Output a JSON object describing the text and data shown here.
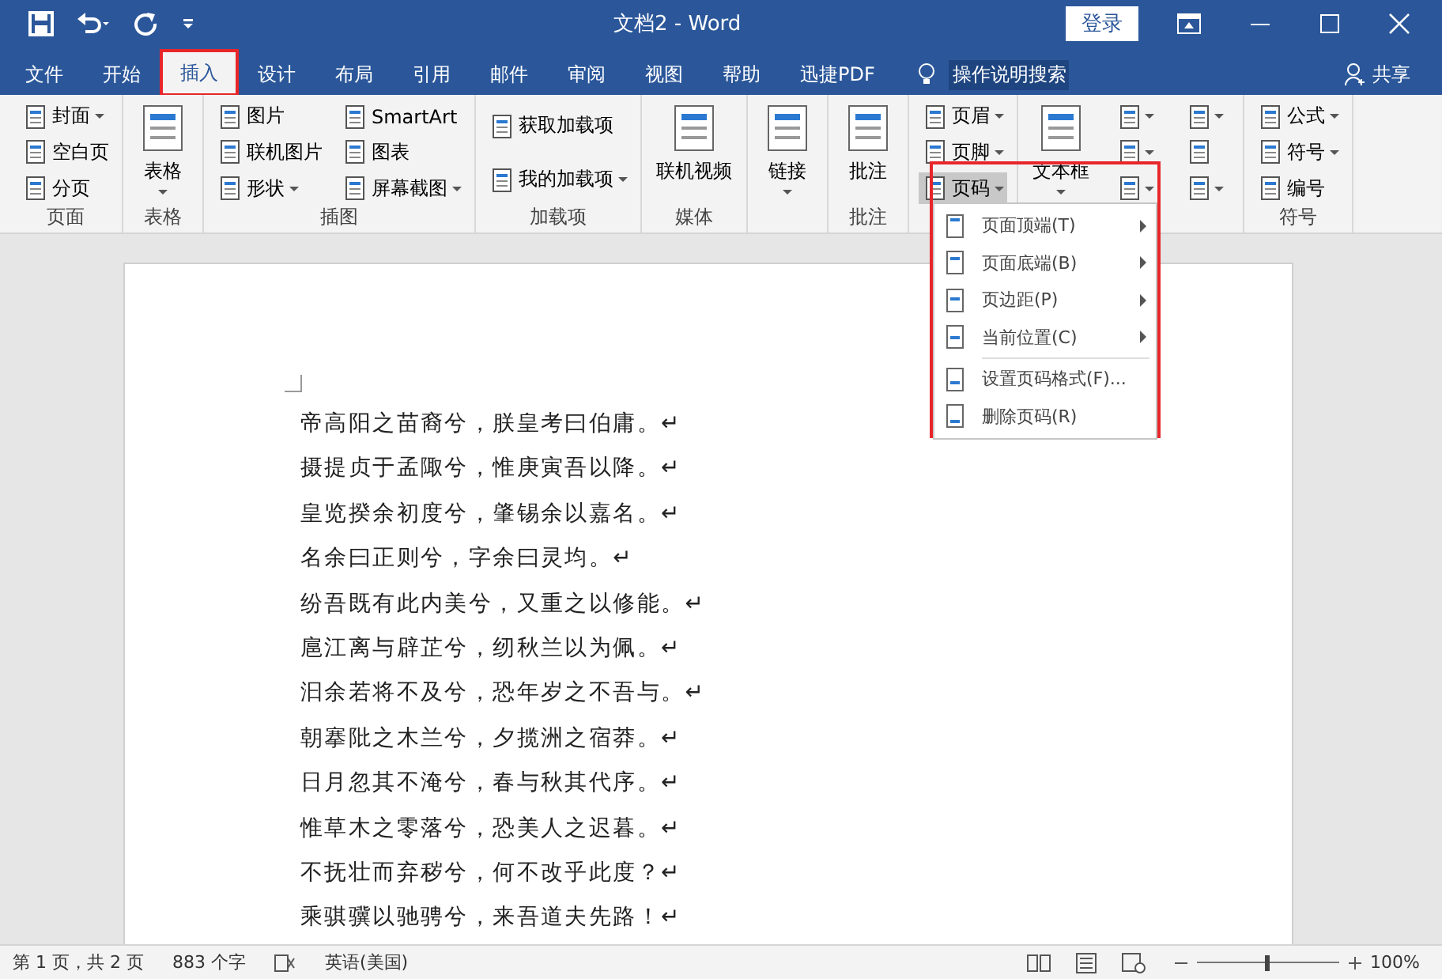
{
  "window": {
    "title": "文档2 - Word",
    "login_button": "登录"
  },
  "tabs": [
    {
      "label": "文件",
      "selected": false
    },
    {
      "label": "开始",
      "selected": false
    },
    {
      "label": "插入",
      "selected": true
    },
    {
      "label": "设计",
      "selected": false
    },
    {
      "label": "布局",
      "selected": false
    },
    {
      "label": "引用",
      "selected": false
    },
    {
      "label": "邮件",
      "selected": false
    },
    {
      "label": "审阅",
      "selected": false
    },
    {
      "label": "视图",
      "selected": false
    },
    {
      "label": "帮助",
      "selected": false
    },
    {
      "label": "迅捷PDF",
      "selected": false
    }
  ],
  "tell_me": "操作说明搜索",
  "share": "共享",
  "ribbon_groups": [
    {
      "label": "页面",
      "items": [
        {
          "kind": "small",
          "label": "封面",
          "dropdown": true
        },
        {
          "kind": "small",
          "label": "空白页",
          "dropdown": false
        },
        {
          "kind": "small",
          "label": "分页",
          "dropdown": false
        }
      ]
    },
    {
      "label": "表格",
      "items": [
        {
          "kind": "large",
          "label": "表格",
          "dropdown": true
        }
      ]
    },
    {
      "label": "插图",
      "items": [
        {
          "kind": "small",
          "label": "图片",
          "dropdown": false
        },
        {
          "kind": "small",
          "label": "联机图片",
          "dropdown": false
        },
        {
          "kind": "small",
          "label": "形状",
          "dropdown": true
        },
        {
          "kind": "small",
          "label": "SmartArt",
          "dropdown": false
        },
        {
          "kind": "small",
          "label": "图表",
          "dropdown": false
        },
        {
          "kind": "small",
          "label": "屏幕截图",
          "dropdown": true
        }
      ]
    },
    {
      "label": "加载项",
      "items": [
        {
          "kind": "small",
          "label": "获取加载项",
          "dropdown": false
        },
        {
          "kind": "small",
          "label": "我的加载项",
          "dropdown": true
        }
      ]
    },
    {
      "label": "媒体",
      "items": [
        {
          "kind": "large",
          "label": "联机视频",
          "dropdown": false
        }
      ]
    },
    {
      "items": [
        {
          "kind": "large",
          "label": "链接",
          "dropdown": true
        }
      ]
    },
    {
      "label": "批注",
      "items": [
        {
          "kind": "large",
          "label": "批注",
          "dropdown": false
        }
      ]
    },
    {
      "items": [
        {
          "kind": "small",
          "label": "页眉",
          "dropdown": true,
          "open": false
        },
        {
          "kind": "small",
          "label": "页脚",
          "dropdown": true,
          "open": false
        },
        {
          "kind": "small",
          "label": "页码",
          "dropdown": true,
          "open": true
        }
      ]
    },
    {
      "items": [
        {
          "kind": "large",
          "label": "文本框",
          "dropdown": true
        },
        {
          "kind": "icon",
          "dropdown": true
        },
        {
          "kind": "icon",
          "dropdown": true
        },
        {
          "kind": "icon",
          "dropdown": true
        },
        {
          "kind": "icon",
          "dropdown": true
        },
        {
          "kind": "icon",
          "dropdown": false
        },
        {
          "kind": "icon",
          "dropdown": true
        }
      ]
    },
    {
      "label": "符号",
      "items": [
        {
          "kind": "small",
          "label": "公式",
          "dropdown": true
        },
        {
          "kind": "small",
          "label": "符号",
          "dropdown": true
        },
        {
          "kind": "small",
          "label": "编号",
          "dropdown": false
        }
      ]
    }
  ],
  "page_number_menu": {
    "items": [
      {
        "label": "页面顶端(T)",
        "submenu": true,
        "separator_before": false
      },
      {
        "label": "页面底端(B)",
        "submenu": true,
        "separator_before": false
      },
      {
        "label": "页边距(P)",
        "submenu": true,
        "separator_before": false
      },
      {
        "label": "当前位置(C)",
        "submenu": true,
        "separator_before": false
      },
      {
        "label": "设置页码格式(F)...",
        "submenu": false,
        "separator_before": true
      },
      {
        "label": "删除页码(R)",
        "submenu": false,
        "separator_before": false
      }
    ]
  },
  "document": {
    "lines": [
      "帝高阳之苗裔兮，朕皇考曰伯庸。↵",
      "摄提贞于孟陬兮，惟庚寅吾以降。↵",
      "皇览揆余初度兮，肇锡余以嘉名。↵",
      "名余曰正则兮，字余曰灵均。↵",
      "纷吾既有此内美兮，又重之以修能。↵",
      "扈江离与辟芷兮，纫秋兰以为佩。↵",
      "汩余若将不及兮，恐年岁之不吾与。↵",
      "朝搴阰之木兰兮，夕揽洲之宿莽。↵",
      "日月忽其不淹兮，春与秋其代序。↵",
      "惟草木之零落兮，恐美人之迟暮。↵",
      "不抚壮而弃秽兮，何不改乎此度？↵",
      "乘骐骥以驰骋兮，来吾道夫先路！↵"
    ]
  },
  "status_bar": {
    "page": "第 1 页，共 2 页",
    "words": "883 个字",
    "language": "英语(美国)",
    "zoom_slider": {
      "level": 0.5
    },
    "zoom": "100%"
  }
}
